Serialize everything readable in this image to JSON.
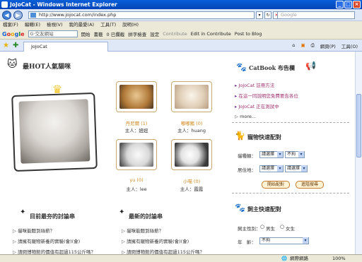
{
  "window": {
    "title": "JoJoCat - Windows Internet Explorer"
  },
  "address": {
    "url": "http://www.jojocat.com/index.php"
  },
  "search_box": {
    "placeholder": "Google"
  },
  "menu": [
    "檔案(F)",
    "編輯(E)",
    "檢視(V)",
    "我的最愛(A)",
    "工具(T)",
    "說明(H)"
  ],
  "google_bar": {
    "logo": "Google",
    "search_value": "G·交友網站",
    "open": "開始",
    "bookmarks": "書籤",
    "blocked": "0 已攔截",
    "check": "拼字檢查",
    "settings": "設定",
    "contribute": "Contribute",
    "edit": "Edit in Contribute",
    "post": "Post to Blog"
  },
  "tab": {
    "label": "JoJoCat"
  },
  "tab_tools": {
    "page": "網頁(P)",
    "tools": "工具(O)"
  },
  "status": {
    "zone": "網際網路",
    "zoom": "100%"
  },
  "popular": {
    "title": "最HOT人氣貓咪",
    "cats": [
      {
        "name": "丹尼爾 (1)",
        "owner": "主人：妞妞"
      },
      {
        "name": "嘟嘟豬 (0)",
        "owner": "主人：huang"
      },
      {
        "name": "yu (0)",
        "owner": "主人：lee"
      },
      {
        "name": "小喵 (0)",
        "owner": "主人：霞霞"
      }
    ]
  },
  "board": {
    "title": "CatBook 布告欄",
    "links": [
      "JoJoCat 註冊方法",
      "在這一同說明您免費要告各位",
      "JoJoCat 正在測試中"
    ],
    "more": "more..."
  },
  "pet_search": {
    "title": "寵物快速配對",
    "breed_label": "貓種類：",
    "breed_select": "請選擇",
    "breed_select2": "不拘",
    "area_label": "居住地：",
    "area_select": "請選擇",
    "area_select2": "請選擇",
    "btn_search": "開始配對",
    "btn_advanced": "進階搜尋"
  },
  "owner_search": {
    "title": "飼主快速配對",
    "gender_label": "飼主性別：",
    "male": "男生",
    "female": "女生",
    "age_label": "年　齡：",
    "age_select": "不拘"
  },
  "discussions": {
    "hot_title": "目前最夯的討論串",
    "new_title": "最新的討論串",
    "hot_items": [
      "貓咪能聽到絲薪？",
      "請擁有寵物新養的實驗(會)(會)",
      "請問博物館的價值有超過115公斤嗎？"
    ],
    "new_items": [
      "貓咪能聽到絲薪？",
      "請擁有寵物新養的實驗(會)(會)",
      "請問博物館的價值有超過115公斤嗎？"
    ]
  }
}
